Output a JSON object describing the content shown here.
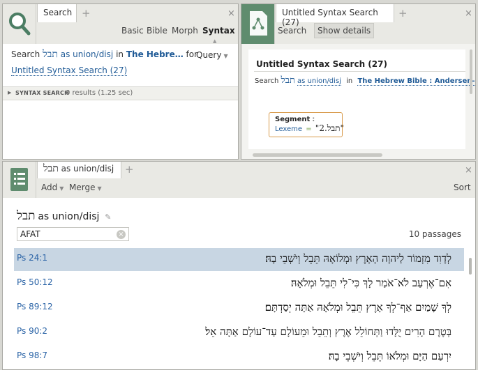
{
  "search_panel": {
    "tab_label": "Search",
    "nav": [
      "Basic",
      "Bible",
      "Morph",
      "Syntax"
    ],
    "query_prefix": "Search",
    "query_hebrew": "תבל",
    "query_mode": "as union/disj",
    "in_label": "in",
    "source": "The Hebre…",
    "for_label": "for",
    "query_dropdown": "Query",
    "saved_search": "Untitled Syntax Search (27)",
    "results_header": "SYNTAX SEARCH",
    "results_summary": "0 results (1.25 sec)"
  },
  "syntax_panel": {
    "tab_label": "Untitled Syntax Search (27)",
    "search_button": "Search",
    "details_button": "Show details",
    "title": "Untitled Syntax Search (27)",
    "search_label": "Search",
    "query_hebrew": "תבל",
    "query_mode": "as union/disj",
    "in_label": "in",
    "source": "The Hebrew Bible : Andersen-Forbes",
    "node_title": "Segment",
    "node_attr": "Lexeme",
    "node_eq": "=",
    "node_value": "\"2.תבל\""
  },
  "passages_panel": {
    "tab_hebrew": "תבל",
    "tab_mode": "as union/disj",
    "add_label": "Add",
    "merge_label": "Merge",
    "sort_label": "Sort",
    "heading_hebrew": "תבל",
    "heading_mode": "as union/disj",
    "filter_value": "AFAT",
    "count": "10 passages",
    "rows": [
      {
        "ref": "Ps 24:1",
        "text": "לְדָוִד מִזְמוֹר לַיהוָה הָאָרֶץ וּמְלוֹאָהּ תֵּבֵל וְיֹשְׁבֵי בָהּ׃"
      },
      {
        "ref": "Ps 50:12",
        "text": "אִם־אֶרְעַב לֹא־אֹמַר לָךְ כִּי־לִי תֵּבֵל וּמְלֹאָהּ׃"
      },
      {
        "ref": "Ps 89:12",
        "text": "לְךָ שָׁמַיִם אַף־לְךָ אָרֶץ תֵּבֵל וּמְלֹאָהּ אַתָּה יְסַדְתָּם׃"
      },
      {
        "ref": "Ps 90:2",
        "text": "בְּטֶרֶם הָרִים יֻלָּדוּ וַתְּחוֹלֵל אֶרֶץ וְתֵבֵל וּמֵעוֹלָם עַד־עוֹלָם אַתָּה אֵל׃"
      },
      {
        "ref": "Ps 98:7",
        "text": "יִרְעַם הַיָּם וּמְלֹאוֹ תֵּבֵל וְיֹשְׁבֵי בָהּ׃"
      }
    ]
  }
}
